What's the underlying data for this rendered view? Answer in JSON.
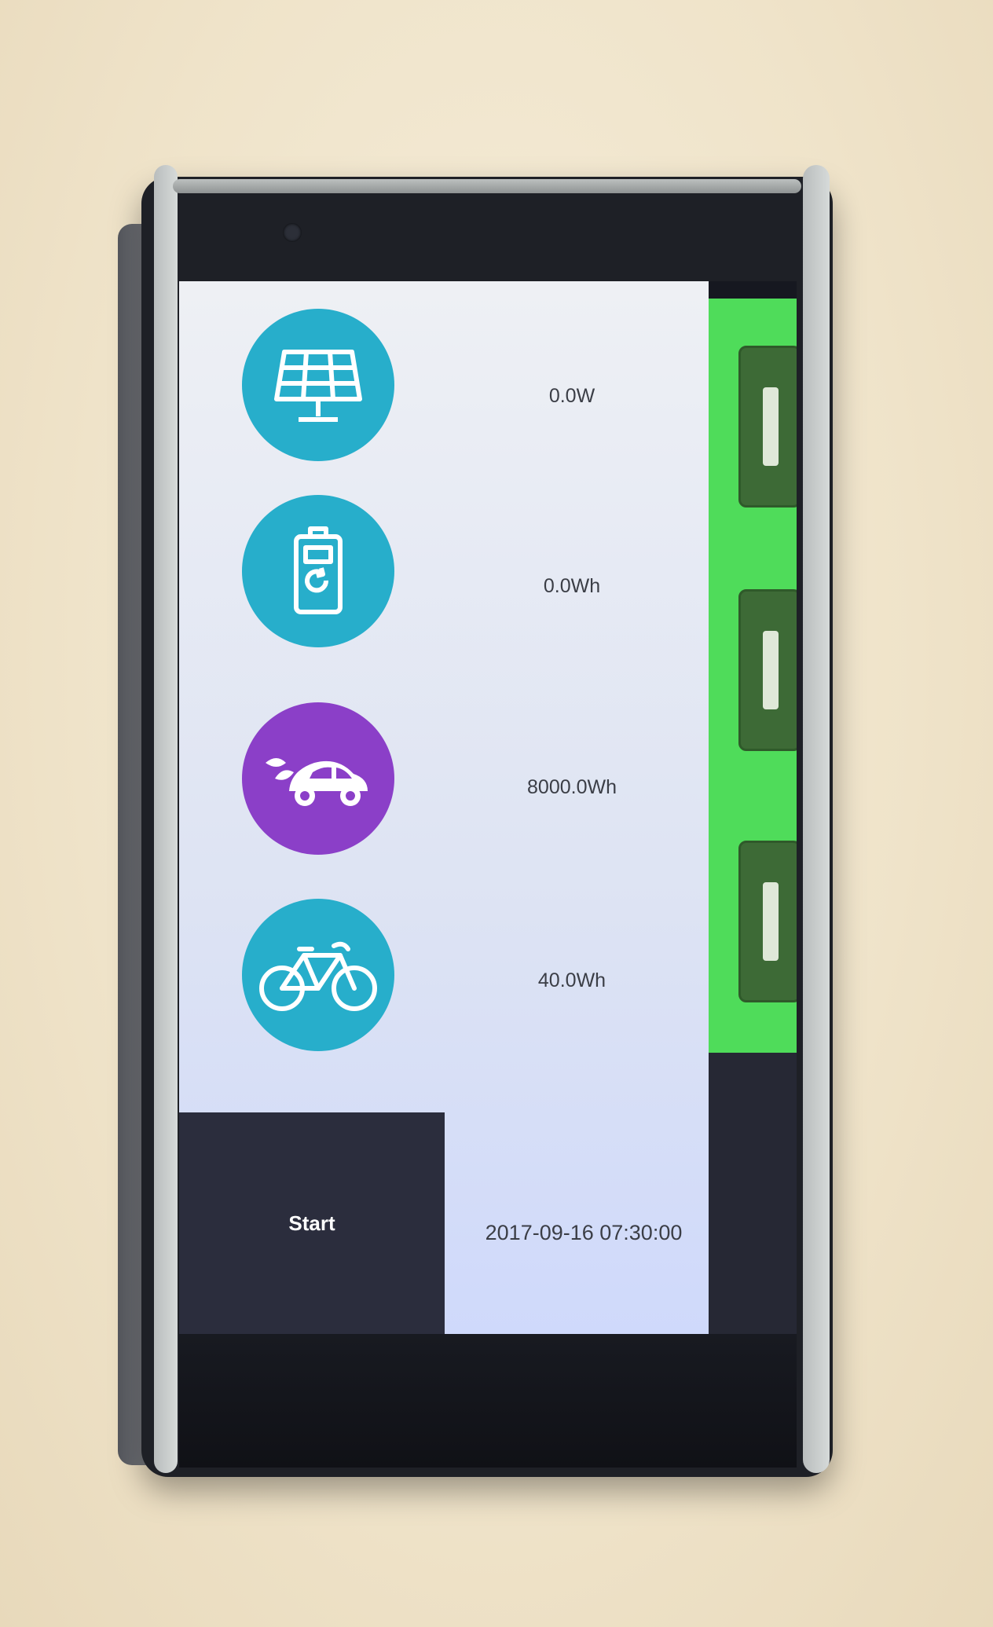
{
  "readings": [
    {
      "id": "solar",
      "value": "0.0W",
      "icon": "solar-panel-icon",
      "color": "#27aecb"
    },
    {
      "id": "battery",
      "value": "0.0Wh",
      "icon": "battery-icon",
      "color": "#27aecb"
    },
    {
      "id": "car",
      "value": "8000.0Wh",
      "icon": "electric-car-icon",
      "color": "#8b3fc8"
    },
    {
      "id": "bike",
      "value": "40.0Wh",
      "icon": "bicycle-icon",
      "color": "#27aecb"
    }
  ],
  "controls": {
    "start_label": "Start"
  },
  "status": {
    "timestamp": "2017-09-16 07:30:00"
  },
  "colors": {
    "side_strip": "#4fdc5a",
    "start_panel": "#2b2d3d",
    "teal": "#27aecb",
    "purple": "#8b3fc8"
  }
}
